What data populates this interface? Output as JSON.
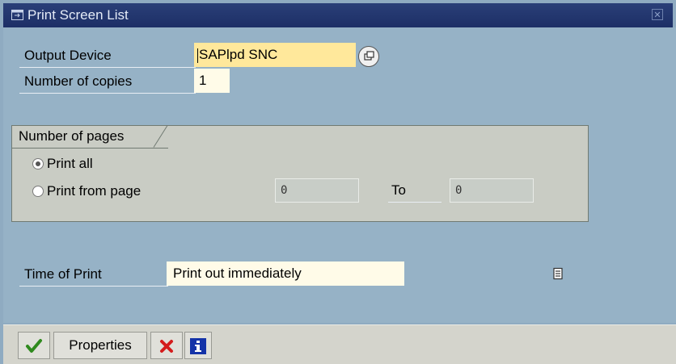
{
  "window": {
    "title": "Print Screen List"
  },
  "fields": {
    "output_device": {
      "label": "Output Device",
      "value": "SAPlpd SNC"
    },
    "copies": {
      "label": "Number of copies",
      "value": "1"
    }
  },
  "pages_group": {
    "title": "Number of pages",
    "print_all": {
      "label": "Print all",
      "checked": true
    },
    "print_from": {
      "label": "Print from page",
      "checked": false,
      "from_value": "0",
      "to_label": "To",
      "to_value": "0"
    }
  },
  "time_of_print": {
    "label": "Time of Print",
    "value": "Print out immediately"
  },
  "toolbar": {
    "continue_icon": "checkmark-icon",
    "properties_label": "Properties",
    "cancel_icon": "cross-icon",
    "info_icon": "info-icon"
  },
  "colors": {
    "titlebar": "#1d2f66",
    "dialog_bg": "#96b2c6",
    "required_field": "#ffe89b",
    "input_field": "#fffbe8",
    "toolbar": "#d4d4cc"
  }
}
